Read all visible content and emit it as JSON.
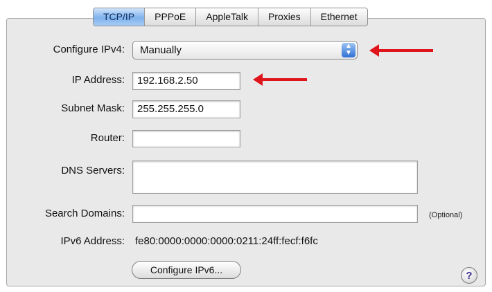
{
  "tabs": [
    "TCP/IP",
    "PPPoE",
    "AppleTalk",
    "Proxies",
    "Ethernet"
  ],
  "configure_ipv4": {
    "label": "Configure IPv4:",
    "value": "Manually",
    "arrows_icon": "up-down-arrows"
  },
  "ip_address": {
    "label": "IP Address:",
    "value": "192.168.2.50"
  },
  "subnet_mask": {
    "label": "Subnet Mask:",
    "value": "255.255.255.0"
  },
  "router": {
    "label": "Router:",
    "value": ""
  },
  "dns_servers": {
    "label": "DNS Servers:",
    "value": ""
  },
  "search_domains": {
    "label": "Search Domains:",
    "value": "",
    "hint": "(Optional)"
  },
  "ipv6": {
    "label": "IPv6 Address:",
    "value": "fe80:0000:0000:0000:0211:24ff:fecf:f6fc"
  },
  "configure_ipv6_button": "Configure IPv6...",
  "help_glyph": "?",
  "annotation_color": "#e0141b"
}
